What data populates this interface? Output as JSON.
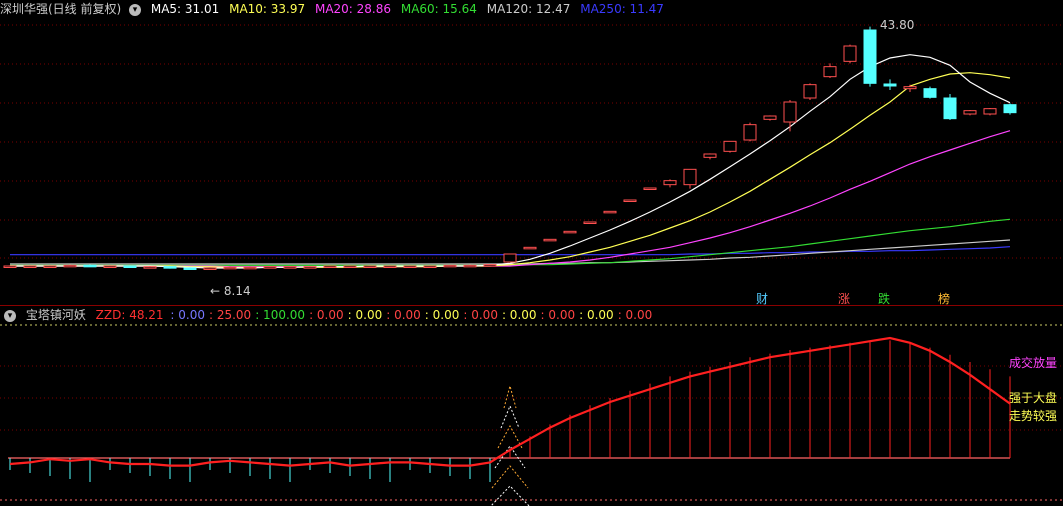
{
  "colors": {
    "bg": "#000000",
    "grid": "#7a0000",
    "up": "#ff5050",
    "down": "#54ffff",
    "ma5": "#ffffff",
    "ma10": "#ffff55",
    "ma20": "#ff44ff",
    "ma60": "#33dd33",
    "ma120": "#cccccc",
    "ma250": "#3a3aff",
    "zzd": "#ff2020"
  },
  "main_header": {
    "title": "深圳华强(日线 前复权)",
    "menu_icon": "chevron-down-icon",
    "ma5": "MA5: 31.01",
    "ma10": "MA10: 33.97",
    "ma20": "MA20: 28.86",
    "ma60": "MA60: 15.64",
    "ma120": "MA120: 12.47",
    "ma250": "MA250: 11.47"
  },
  "price_labels": {
    "high": "43.80",
    "low": "← 8.14"
  },
  "event_badges": [
    {
      "label": "财",
      "color": "#54ccff"
    },
    {
      "label": "涨",
      "color": "#ff5050"
    },
    {
      "label": "跌",
      "color": "#33dd33"
    },
    {
      "label": "榜",
      "color": "#ffbb33"
    }
  ],
  "indicator_header": {
    "name": "宝塔镇河妖",
    "menu_icon": "chevron-down-icon",
    "zzd": "ZZD: 48.21",
    "values": [
      {
        "text": ": 0.00",
        "color": "#7777ff"
      },
      {
        "text": ": 25.00",
        "color": "#ff4444"
      },
      {
        "text": ": 100.00",
        "color": "#33dd33"
      },
      {
        "text": ": 0.00",
        "color": "#ff4444"
      },
      {
        "text": ": 0.00",
        "color": "#ffff55"
      },
      {
        "text": ": 0.00",
        "color": "#ff4444"
      },
      {
        "text": ": 0.00",
        "color": "#ffff55"
      },
      {
        "text": ": 0.00",
        "color": "#ff4444"
      },
      {
        "text": ": 0.00",
        "color": "#ffff55"
      },
      {
        "text": ": 0.00",
        "color": "#ff4444"
      },
      {
        "text": ": 0.00",
        "color": "#ffff55"
      },
      {
        "text": ": 0.00",
        "color": "#ff4444"
      }
    ]
  },
  "indicator_notes": {
    "volume_up": "成交放量",
    "stronger_line1": "强于大盘",
    "stronger_line2": "走势较强"
  },
  "chart_data": {
    "type": "candlestick",
    "ylim": [
      5,
      47
    ],
    "candles": [
      [
        8.6,
        8.7,
        8.5,
        8.6
      ],
      [
        8.6,
        8.7,
        8.5,
        8.6
      ],
      [
        8.6,
        8.7,
        8.5,
        8.6
      ],
      [
        8.6,
        8.8,
        8.5,
        8.7
      ],
      [
        8.7,
        8.8,
        8.6,
        8.6
      ],
      [
        8.6,
        8.7,
        8.5,
        8.6
      ],
      [
        8.6,
        8.7,
        8.5,
        8.5
      ],
      [
        8.5,
        8.6,
        8.4,
        8.5
      ],
      [
        8.5,
        8.6,
        8.2,
        8.3
      ],
      [
        8.3,
        8.4,
        8.14,
        8.2
      ],
      [
        8.2,
        8.4,
        8.14,
        8.3
      ],
      [
        8.3,
        8.5,
        8.2,
        8.4
      ],
      [
        8.4,
        8.5,
        8.3,
        8.4
      ],
      [
        8.4,
        8.6,
        8.3,
        8.5
      ],
      [
        8.5,
        8.6,
        8.4,
        8.5
      ],
      [
        8.5,
        8.6,
        8.4,
        8.5
      ],
      [
        8.5,
        8.7,
        8.4,
        8.6
      ],
      [
        8.6,
        8.7,
        8.5,
        8.6
      ],
      [
        8.6,
        8.7,
        8.5,
        8.6
      ],
      [
        8.6,
        8.7,
        8.5,
        8.6
      ],
      [
        8.6,
        8.7,
        8.5,
        8.6
      ],
      [
        8.6,
        8.7,
        8.5,
        8.6
      ],
      [
        8.6,
        8.7,
        8.5,
        8.7
      ],
      [
        8.7,
        8.8,
        8.6,
        8.7
      ],
      [
        8.7,
        8.8,
        8.6,
        8.8
      ],
      [
        9.2,
        10.4,
        9.2,
        10.4
      ],
      [
        11.4,
        11.4,
        11.4,
        11.4
      ],
      [
        12.6,
        12.6,
        12.6,
        12.6
      ],
      [
        13.8,
        13.8,
        13.8,
        13.8
      ],
      [
        15.2,
        15.2,
        15.2,
        15.2
      ],
      [
        16.8,
        16.8,
        16.8,
        16.8
      ],
      [
        18.5,
        18.5,
        18.5,
        18.5
      ],
      [
        20.3,
        20.3,
        20.3,
        20.3
      ],
      [
        20.8,
        21.6,
        20.4,
        21.4
      ],
      [
        20.8,
        22.9,
        20.2,
        23.1
      ],
      [
        24.9,
        25.5,
        24.6,
        25.4
      ],
      [
        25.8,
        27.3,
        25.6,
        27.3
      ],
      [
        27.5,
        30.1,
        27.3,
        29.8
      ],
      [
        30.6,
        31.2,
        30.4,
        31.1
      ],
      [
        30.2,
        33.5,
        28.8,
        33.2
      ],
      [
        33.8,
        36.0,
        33.5,
        35.8
      ],
      [
        37.0,
        39.0,
        36.8,
        38.5
      ],
      [
        39.3,
        41.8,
        39.0,
        41.6
      ],
      [
        44.0,
        44.5,
        35.5,
        36.0
      ],
      [
        35.9,
        36.6,
        35.0,
        35.6
      ],
      [
        35.2,
        35.8,
        34.7,
        35.5
      ],
      [
        35.2,
        35.5,
        33.7,
        33.9
      ],
      [
        33.8,
        34.4,
        30.5,
        30.7
      ],
      [
        31.4,
        32.0,
        31.2,
        31.9
      ],
      [
        31.4,
        32.3,
        31.2,
        32.2
      ],
      [
        32.8,
        33.0,
        31.3,
        31.6
      ]
    ],
    "ma5": [
      8.6,
      8.6,
      8.6,
      8.6,
      8.6,
      8.6,
      8.6,
      8.6,
      8.5,
      8.4,
      8.3,
      8.3,
      8.3,
      8.4,
      8.4,
      8.5,
      8.5,
      8.5,
      8.6,
      8.6,
      8.6,
      8.6,
      8.6,
      8.6,
      8.7,
      9.0,
      9.6,
      10.5,
      11.6,
      12.8,
      14.0,
      15.3,
      16.7,
      18.2,
      19.8,
      21.6,
      23.5,
      25.4,
      27.4,
      29.5,
      31.8,
      34.0,
      36.6,
      38.5,
      39.8,
      40.3,
      39.9,
      38.7,
      36.2,
      34.5,
      33.1
    ],
    "ma10": [
      8.6,
      8.6,
      8.6,
      8.6,
      8.6,
      8.6,
      8.6,
      8.6,
      8.6,
      8.5,
      8.5,
      8.4,
      8.4,
      8.4,
      8.4,
      8.4,
      8.4,
      8.4,
      8.5,
      8.5,
      8.5,
      8.5,
      8.6,
      8.6,
      8.6,
      8.8,
      9.1,
      9.5,
      10.0,
      10.7,
      11.4,
      12.3,
      13.2,
      14.3,
      15.4,
      16.7,
      18.2,
      19.8,
      21.6,
      23.4,
      25.3,
      27.1,
      29.1,
      31.2,
      33.2,
      35.6,
      36.6,
      37.4,
      37.6,
      37.3,
      36.8
    ],
    "ma20": [
      8.6,
      8.6,
      8.6,
      8.6,
      8.6,
      8.6,
      8.6,
      8.6,
      8.6,
      8.6,
      8.6,
      8.5,
      8.5,
      8.5,
      8.5,
      8.5,
      8.5,
      8.5,
      8.5,
      8.5,
      8.5,
      8.5,
      8.6,
      8.6,
      8.6,
      8.6,
      8.8,
      9.0,
      9.2,
      9.5,
      9.9,
      10.4,
      10.9,
      11.4,
      12.1,
      12.8,
      13.6,
      14.5,
      15.5,
      16.5,
      17.6,
      18.8,
      20.1,
      21.3,
      22.6,
      23.9,
      25.0,
      26.0,
      27.0,
      28.0,
      28.9
    ],
    "ma60": [
      8.7,
      8.7,
      8.7,
      8.7,
      8.7,
      8.7,
      8.7,
      8.7,
      8.7,
      8.7,
      8.7,
      8.7,
      8.7,
      8.7,
      8.7,
      8.7,
      8.7,
      8.7,
      8.7,
      8.7,
      8.7,
      8.7,
      8.7,
      8.7,
      8.7,
      8.7,
      8.8,
      8.8,
      8.9,
      9.0,
      9.1,
      9.3,
      9.5,
      9.7,
      10.0,
      10.3,
      10.6,
      10.9,
      11.2,
      11.5,
      11.9,
      12.3,
      12.7,
      13.1,
      13.5,
      13.9,
      14.2,
      14.5,
      14.9,
      15.3,
      15.6
    ],
    "ma120": [
      8.9,
      8.9,
      8.9,
      8.9,
      8.9,
      8.9,
      8.9,
      8.9,
      8.9,
      8.9,
      8.9,
      8.9,
      8.9,
      8.9,
      8.9,
      8.9,
      8.9,
      8.9,
      8.9,
      8.9,
      8.9,
      8.9,
      8.9,
      8.9,
      8.9,
      8.9,
      8.9,
      9.0,
      9.0,
      9.1,
      9.1,
      9.2,
      9.3,
      9.4,
      9.5,
      9.6,
      9.8,
      9.9,
      10.1,
      10.3,
      10.5,
      10.7,
      10.9,
      11.1,
      11.3,
      11.5,
      11.7,
      11.9,
      12.1,
      12.3,
      12.5
    ],
    "ma250": [
      10.3,
      10.3,
      10.3,
      10.3,
      10.3,
      10.3,
      10.3,
      10.3,
      10.3,
      10.3,
      10.3,
      10.3,
      10.3,
      10.3,
      10.3,
      10.3,
      10.3,
      10.3,
      10.3,
      10.3,
      10.3,
      10.3,
      10.3,
      10.3,
      10.3,
      10.3,
      10.3,
      10.3,
      10.3,
      10.3,
      10.3,
      10.3,
      10.3,
      10.3,
      10.4,
      10.4,
      10.5,
      10.5,
      10.6,
      10.6,
      10.7,
      10.7,
      10.8,
      10.8,
      10.9,
      10.9,
      11.0,
      11.1,
      11.2,
      11.3,
      11.5
    ],
    "zzd": [
      0,
      0,
      0,
      0,
      0,
      0,
      0,
      0,
      0,
      0,
      0,
      0,
      0,
      0,
      0,
      0,
      0,
      0,
      0,
      0,
      0,
      0,
      0,
      0,
      0,
      4,
      9,
      14,
      18,
      22,
      25,
      28,
      31,
      34,
      36,
      38,
      40,
      42,
      43.5,
      45,
      46,
      47,
      48,
      48.5,
      49,
      48,
      46,
      43,
      40,
      37,
      34
    ],
    "zzd_line": [
      23,
      24,
      26,
      25,
      26,
      24,
      23,
      23,
      22,
      22,
      24,
      25,
      24,
      23,
      22,
      23,
      24,
      22,
      23,
      24,
      24,
      23,
      22,
      22,
      24,
      28,
      35,
      42,
      48,
      53,
      58,
      62,
      66,
      70,
      74,
      77,
      80,
      83,
      86,
      88,
      90,
      92,
      94,
      96,
      98,
      95,
      90,
      83,
      75,
      66,
      57
    ]
  }
}
